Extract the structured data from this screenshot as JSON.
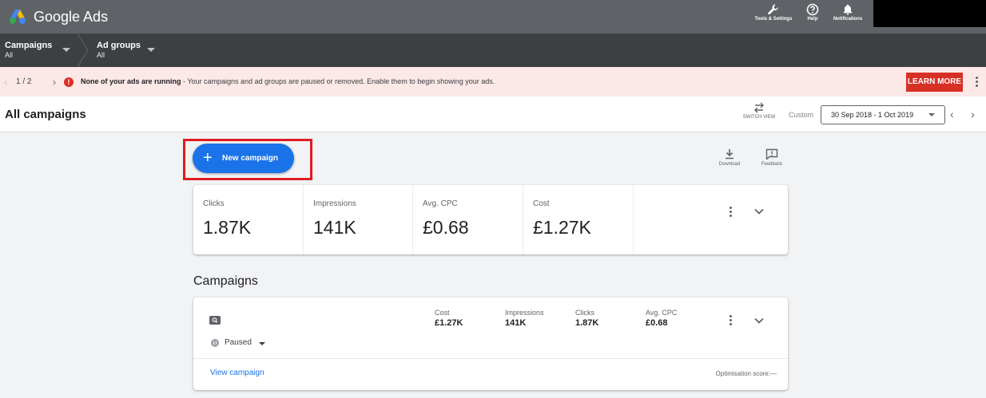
{
  "app": {
    "title": "Google Ads"
  },
  "topbar": {
    "tools_label": "Tools & Settings",
    "help_label": "Help",
    "notifications_label": "Notifications"
  },
  "scope": {
    "campaigns_title": "Campaigns",
    "campaigns_value": "All",
    "adgroups_title": "Ad groups",
    "adgroups_value": "All"
  },
  "alert": {
    "pager": "1 / 2",
    "prev": "‹",
    "next": "›",
    "icon": "!",
    "bold_text": "None of your ads are running",
    "text": " - Your campaigns and ad groups are paused or removed. Enable them to begin showing your ads.",
    "action_label": "LEARN MORE"
  },
  "header": {
    "title": "All campaigns",
    "switch_view_label": "SWITCH VIEW",
    "date_mode": "Custom",
    "date_range": "30 Sep 2018 - 1 Oct 2019",
    "prev": "‹",
    "next": "›"
  },
  "toolbar": {
    "new_campaign_label": "New campaign",
    "download_label": "Download",
    "feedback_label": "Feedback"
  },
  "summary": {
    "metrics": [
      {
        "label": "Clicks",
        "value": "1.87K"
      },
      {
        "label": "Impressions",
        "value": "141K"
      },
      {
        "label": "Avg. CPC",
        "value": "£0.68"
      },
      {
        "label": "Cost",
        "value": "£1.27K"
      }
    ]
  },
  "campaigns": {
    "section_title": "Campaigns",
    "card": {
      "status": "Paused",
      "metrics": [
        {
          "label": "Cost",
          "value": "£1.27K"
        },
        {
          "label": "Impressions",
          "value": "141K"
        },
        {
          "label": "Clicks",
          "value": "1.87K"
        },
        {
          "label": "Avg. CPC",
          "value": "£0.68"
        }
      ],
      "view_link": "View campaign",
      "optimisation_score": "Optimisation score:—"
    }
  },
  "colors": {
    "brand_blue": "#1a73e8",
    "alert_red": "#d93025",
    "highlight_red": "#e11b22",
    "topbar": "#5f6368",
    "scopebar": "#3c4043"
  },
  "icons": {
    "logo": "google-ads-logo",
    "tools": "wrench-icon",
    "help": "help-icon",
    "notifications": "bell-icon",
    "switch_view": "switch-arrows-icon",
    "download": "download-icon",
    "feedback": "feedback-icon",
    "search_campaign": "search-campaign-icon"
  }
}
